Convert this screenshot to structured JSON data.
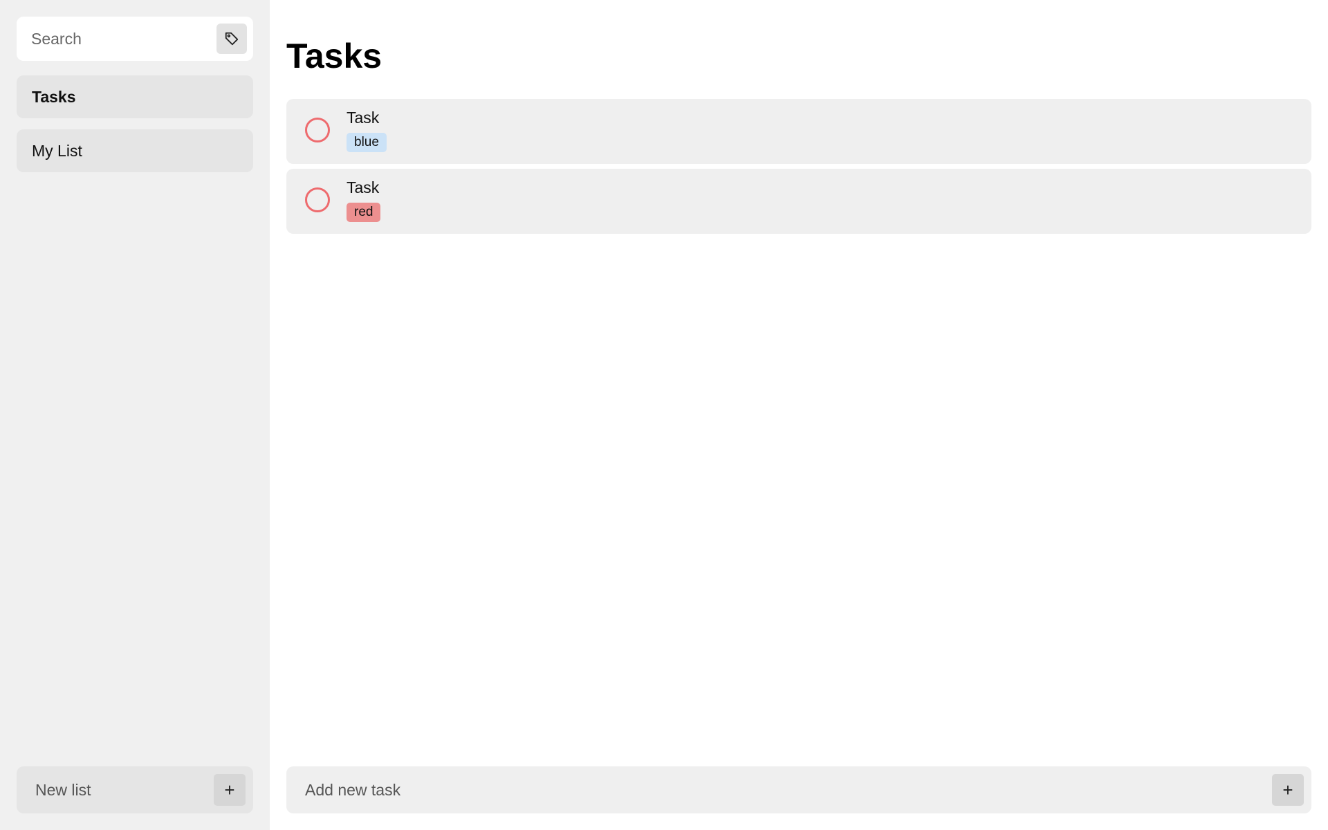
{
  "sidebar": {
    "search": {
      "placeholder": "Search",
      "value": ""
    },
    "tag_filter_icon": "tag-icon",
    "lists": [
      {
        "label": "Tasks",
        "active": true
      },
      {
        "label": "My List",
        "active": false
      }
    ],
    "new_list": {
      "placeholder": "New list",
      "add_label": "+"
    }
  },
  "main": {
    "title": "Tasks",
    "tasks": [
      {
        "title": "Task",
        "tag": "blue",
        "tag_color": "#cbe2f7",
        "done": false
      },
      {
        "title": "Task",
        "tag": "red",
        "tag_color": "#ec8f8f",
        "done": false
      }
    ],
    "add_task": {
      "placeholder": "Add new task",
      "add_label": "+"
    }
  },
  "colors": {
    "checkbox_ring": "#ee6b6e",
    "sidebar_bg": "#f0f0f0",
    "row_bg": "#efefef"
  }
}
